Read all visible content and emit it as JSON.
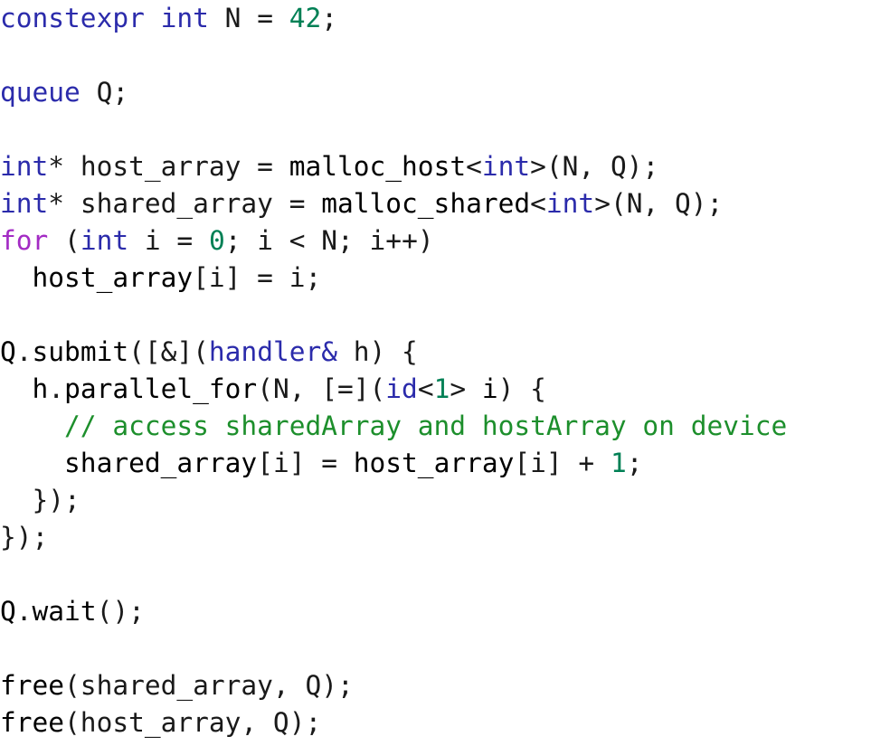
{
  "document": {
    "kind": "source-code-listing",
    "language": "C++ (SYCL)",
    "background": "#ffffff",
    "palette": {
      "plain": "#1a1a1a",
      "keyword": "#2b2bab",
      "control": "#a32bc4",
      "type": "#2b2bab",
      "variable": "#2b2bab",
      "function": "#8d7a23",
      "number": "#008055",
      "comment": "#1d8f2c"
    }
  },
  "code": {
    "lines": [
      {
        "n": 1,
        "text": "constexpr int N = 42;",
        "tokens": [
          {
            "t": "constexpr",
            "c": "keyword"
          },
          {
            "t": " ",
            "c": "plain"
          },
          {
            "t": "int",
            "c": "type"
          },
          {
            "t": " N = ",
            "c": "plain"
          },
          {
            "t": "42",
            "c": "number"
          },
          {
            "t": ";",
            "c": "punct"
          }
        ]
      },
      {
        "n": 2,
        "text": "",
        "tokens": []
      },
      {
        "n": 3,
        "text": "queue Q;",
        "tokens": [
          {
            "t": "queue",
            "c": "keyword"
          },
          {
            "t": " Q;",
            "c": "plain"
          }
        ]
      },
      {
        "n": 4,
        "text": "",
        "tokens": []
      },
      {
        "n": 5,
        "text": "int* host_array = malloc_host<int>(N, Q);",
        "tokens": [
          {
            "t": "int",
            "c": "type"
          },
          {
            "t": "* host_array = ",
            "c": "plain"
          },
          {
            "t": "malloc_host",
            "c": "function"
          },
          {
            "t": "<",
            "c": "punct"
          },
          {
            "t": "int",
            "c": "type"
          },
          {
            "t": ">(N, Q);",
            "c": "punct"
          }
        ]
      },
      {
        "n": 6,
        "text": "int* shared_array = malloc_shared<int>(N, Q);",
        "tokens": [
          {
            "t": "int",
            "c": "type"
          },
          {
            "t": "* shared_array = ",
            "c": "plain"
          },
          {
            "t": "malloc_shared",
            "c": "function"
          },
          {
            "t": "<",
            "c": "punct"
          },
          {
            "t": "int",
            "c": "type"
          },
          {
            "t": ">(N, Q);",
            "c": "punct"
          }
        ]
      },
      {
        "n": 7,
        "text": "for (int i = 0; i < N; i++)",
        "tokens": [
          {
            "t": "for",
            "c": "control"
          },
          {
            "t": " (",
            "c": "plain"
          },
          {
            "t": "int",
            "c": "type"
          },
          {
            "t": " i = ",
            "c": "plain"
          },
          {
            "t": "0",
            "c": "number"
          },
          {
            "t": "; i < N; i++)",
            "c": "plain"
          }
        ]
      },
      {
        "n": 8,
        "text": "  host_array[i] = i;",
        "tokens": [
          {
            "t": "  ",
            "c": "plain"
          },
          {
            "t": "host_array",
            "c": "variable"
          },
          {
            "t": "[i] = i;",
            "c": "plain"
          }
        ]
      },
      {
        "n": 9,
        "text": "",
        "tokens": []
      },
      {
        "n": 10,
        "text": "Q.submit([&](handler& h) {",
        "tokens": [
          {
            "t": "Q",
            "c": "variable"
          },
          {
            "t": ".",
            "c": "plain"
          },
          {
            "t": "submit",
            "c": "function"
          },
          {
            "t": "([&](",
            "c": "plain"
          },
          {
            "t": "handler&",
            "c": "type"
          },
          {
            "t": " h) {",
            "c": "plain"
          }
        ]
      },
      {
        "n": 11,
        "text": "  h.parallel_for(N, [=](id<1> i) {",
        "tokens": [
          {
            "t": "  ",
            "c": "plain"
          },
          {
            "t": "h",
            "c": "variable"
          },
          {
            "t": ".",
            "c": "plain"
          },
          {
            "t": "parallel_for",
            "c": "function"
          },
          {
            "t": "(N, [=](",
            "c": "plain"
          },
          {
            "t": "id",
            "c": "type"
          },
          {
            "t": "<",
            "c": "plain"
          },
          {
            "t": "1",
            "c": "number"
          },
          {
            "t": "> ",
            "c": "plain"
          },
          {
            "t": "i",
            "c": "variable"
          },
          {
            "t": ") {",
            "c": "plain"
          }
        ]
      },
      {
        "n": 12,
        "text": "    // access sharedArray and hostArray on device",
        "tokens": [
          {
            "t": "    ",
            "c": "plain"
          },
          {
            "t": "// access sharedArray and hostArray on device",
            "c": "comment"
          }
        ]
      },
      {
        "n": 13,
        "text": "    shared_array[i] = host_array[i] + 1;",
        "tokens": [
          {
            "t": "    ",
            "c": "plain"
          },
          {
            "t": "shared_array",
            "c": "variable"
          },
          {
            "t": "[i] = ",
            "c": "plain"
          },
          {
            "t": "host_array",
            "c": "variable"
          },
          {
            "t": "[i] + ",
            "c": "plain"
          },
          {
            "t": "1",
            "c": "number"
          },
          {
            "t": ";",
            "c": "plain"
          }
        ]
      },
      {
        "n": 14,
        "text": "  });",
        "tokens": [
          {
            "t": "  });",
            "c": "plain"
          }
        ]
      },
      {
        "n": 15,
        "text": "});",
        "tokens": [
          {
            "t": "});",
            "c": "plain"
          }
        ]
      },
      {
        "n": 16,
        "text": "",
        "tokens": []
      },
      {
        "n": 17,
        "text": "Q.wait();",
        "tokens": [
          {
            "t": "Q",
            "c": "variable"
          },
          {
            "t": ".",
            "c": "plain"
          },
          {
            "t": "wait",
            "c": "function"
          },
          {
            "t": "();",
            "c": "plain"
          }
        ]
      },
      {
        "n": 18,
        "text": "",
        "tokens": []
      },
      {
        "n": 19,
        "text": "free(shared_array, Q);",
        "tokens": [
          {
            "t": "free",
            "c": "function"
          },
          {
            "t": "(shared_array, Q);",
            "c": "plain"
          }
        ]
      },
      {
        "n": 20,
        "text": "free(host_array, Q);",
        "tokens": [
          {
            "t": "free",
            "c": "function"
          },
          {
            "t": "(host_array, Q);",
            "c": "plain"
          }
        ]
      }
    ]
  }
}
